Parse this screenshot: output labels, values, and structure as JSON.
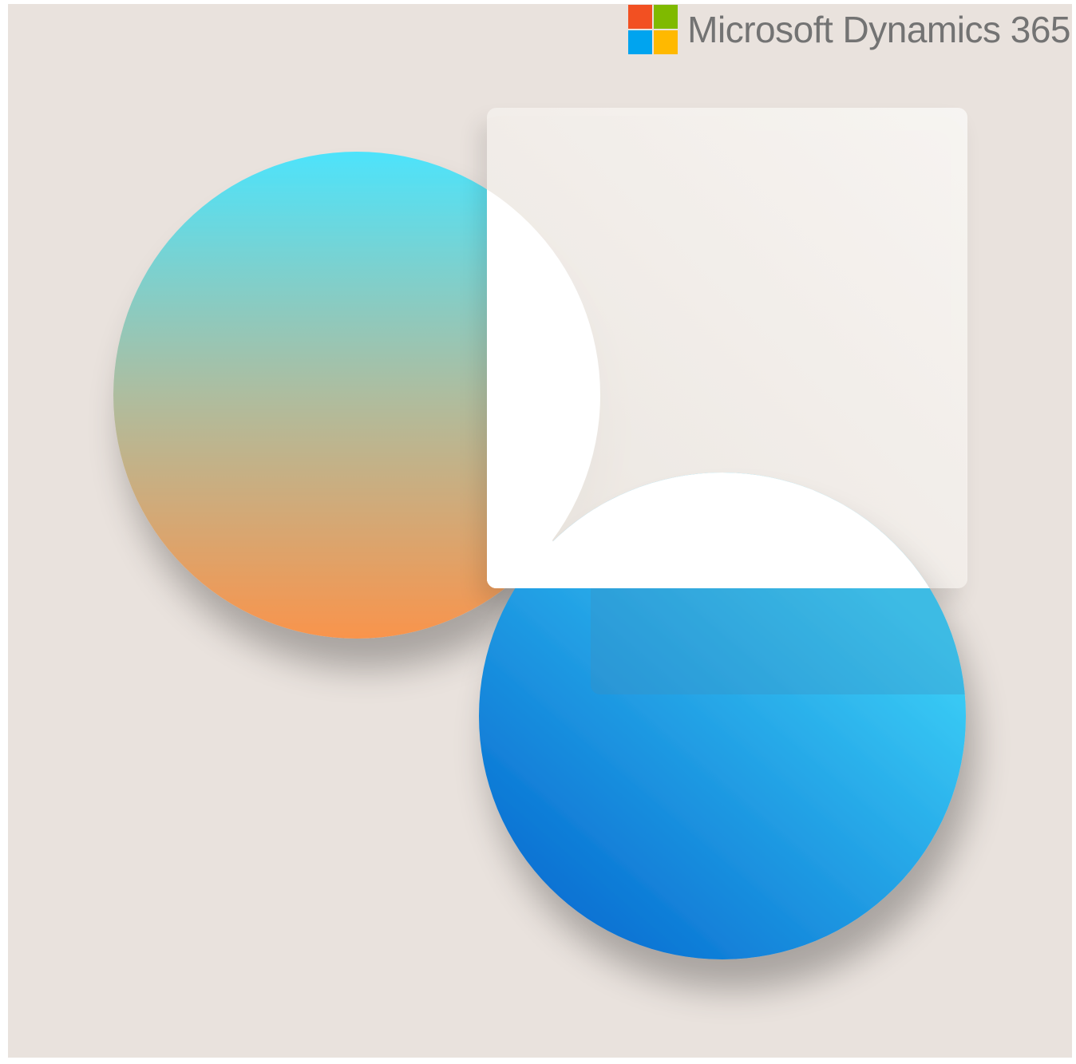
{
  "brand": {
    "name": "Microsoft Dynamics 365",
    "logo_icon": "microsoft-four-square-logo",
    "logo_colors": [
      "#f25022",
      "#7fba00",
      "#00a4ef",
      "#ffb900"
    ]
  },
  "colors": {
    "background": "#e9e2dd",
    "orange_circle_top": "#4de3fb",
    "orange_circle_bottom": "#f9944c",
    "blue_circle_top": "#3cd0f7",
    "blue_circle_bottom": "#0a72d3",
    "panel": "#f3efea",
    "white_shape": "#ffffff"
  }
}
